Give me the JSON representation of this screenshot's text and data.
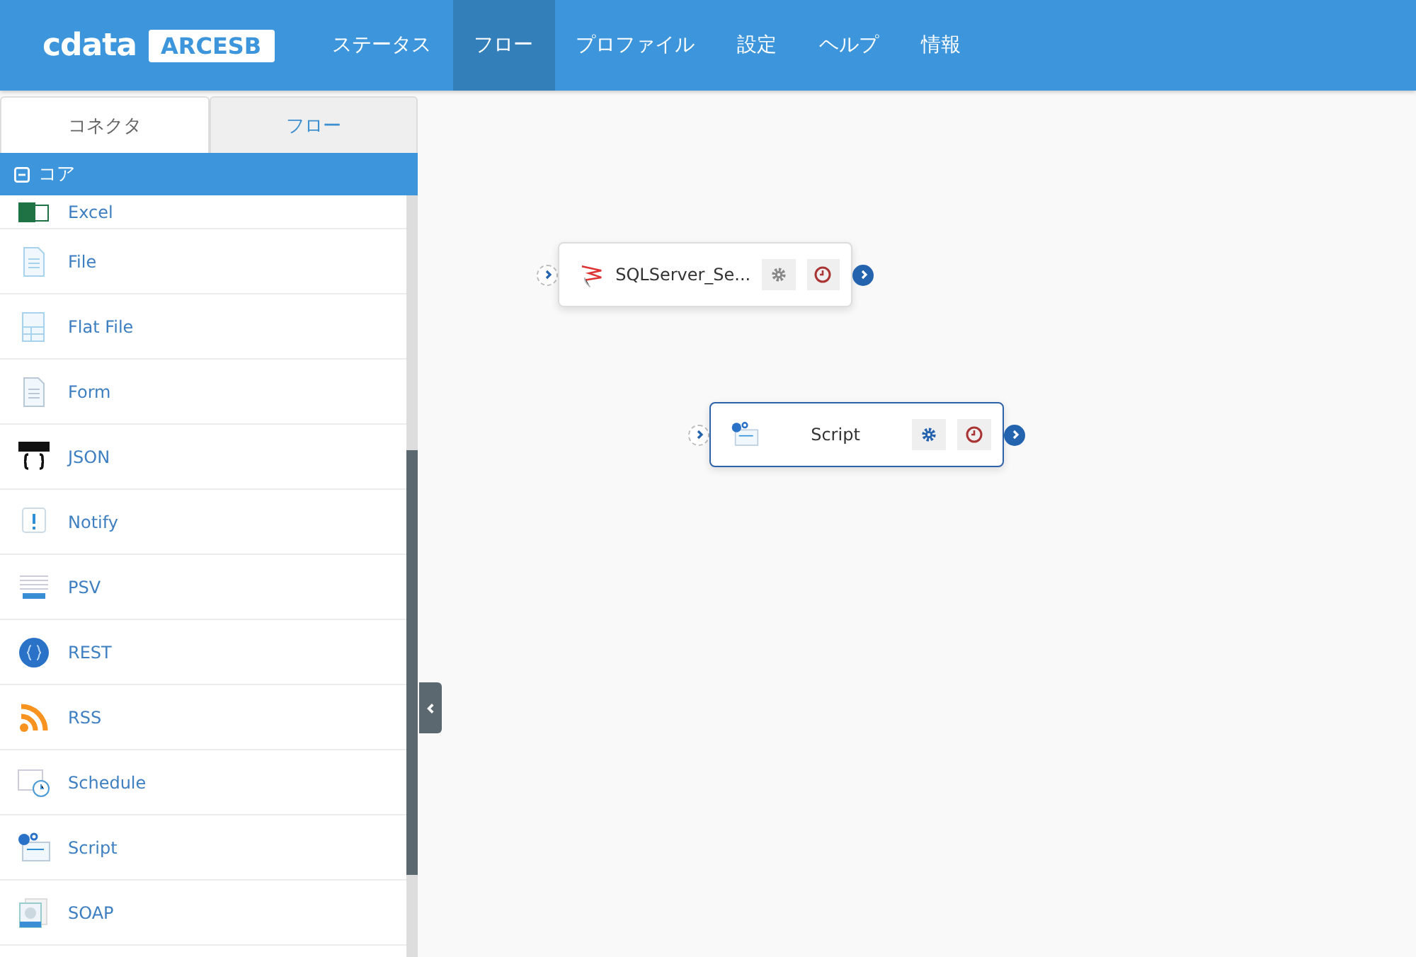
{
  "header": {
    "logo": "cdata",
    "product": "ARCESB",
    "nav": [
      {
        "label": "ステータス",
        "selected": false
      },
      {
        "label": "フロー",
        "selected": true
      },
      {
        "label": "プロファイル",
        "selected": false
      },
      {
        "label": "設定",
        "selected": false
      },
      {
        "label": "ヘルプ",
        "selected": false
      },
      {
        "label": "情報",
        "selected": false
      }
    ]
  },
  "sidebar": {
    "tabs": [
      {
        "label": "コネクタ",
        "selected": true
      },
      {
        "label": "フロー",
        "selected": false
      }
    ],
    "group": {
      "label": "コア",
      "expanded": true
    },
    "connectors": [
      "Excel",
      "File",
      "Flat File",
      "Form",
      "JSON",
      "Notify",
      "PSV",
      "REST",
      "RSS",
      "Schedule",
      "Script",
      "SOAP"
    ]
  },
  "canvas": {
    "nodes": [
      {
        "label": "SQLServer_Se...",
        "selected": false
      },
      {
        "label": "Script",
        "selected": true
      }
    ]
  }
}
